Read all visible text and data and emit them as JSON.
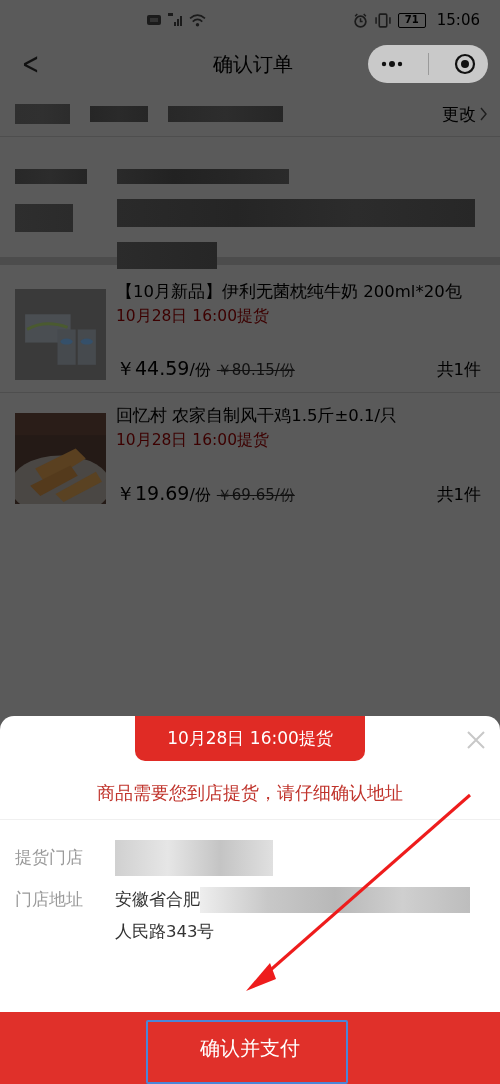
{
  "status_bar": {
    "battery": "71",
    "time": "15:06"
  },
  "nav": {
    "back": "<",
    "title": "确认订单"
  },
  "address": {
    "change": "更改"
  },
  "products": [
    {
      "title": "【10月新品】伊利无菌枕纯牛奶 200ml*20包",
      "pickup": "10月28日 16:00提货",
      "price": "￥44.59",
      "unit": "/份",
      "original_price": "￥80.15/份",
      "quantity": "共1件"
    },
    {
      "title": "回忆村 农家自制风干鸡1.5斤±0.1/只",
      "pickup": "10月28日 16:00提货",
      "price": "￥19.69",
      "unit": "/份",
      "original_price": "￥69.65/份",
      "quantity": "共1件"
    }
  ],
  "sheet": {
    "pickup_banner": "10月28日 16:00提货",
    "notice": "商品需要您到店提货，请仔细确认地址",
    "fields": [
      {
        "label": "提货门店"
      },
      {
        "label": "门店地址",
        "value_lines": [
          "安徽省合肥",
          "人民路343号"
        ]
      }
    ]
  },
  "footer": {
    "pay_button": "确认并支付"
  },
  "annotations": {
    "arrow": true,
    "frame": true
  }
}
